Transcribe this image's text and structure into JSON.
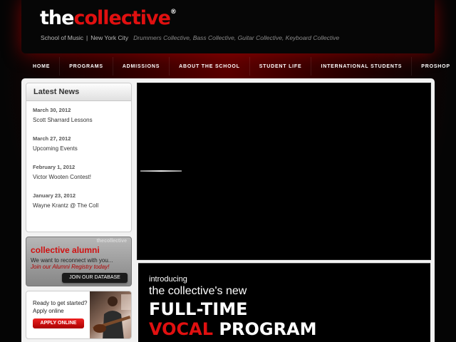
{
  "header": {
    "logo_white": "the",
    "logo_red": "collective",
    "logo_mark": "®",
    "tagline_school": "School of Music",
    "tagline_sep": "|",
    "tagline_city": "New York City",
    "tagline_sub": "Drummers Collective, Bass Collective, Guitar Collective, Keyboard Collective"
  },
  "nav": [
    {
      "label": "HOME"
    },
    {
      "label": "PROGRAMS"
    },
    {
      "label": "ADMISSIONS"
    },
    {
      "label": "ABOUT THE SCHOOL"
    },
    {
      "label": "STUDENT LIFE"
    },
    {
      "label": "INTERNATIONAL STUDENTS"
    },
    {
      "label": "PROSHOP"
    }
  ],
  "news": {
    "title": "Latest News",
    "items": [
      {
        "date": "March 30, 2012",
        "title": "Scott Sharrard Lessons"
      },
      {
        "date": "March 27, 2012",
        "title": "Upcoming Events"
      },
      {
        "date": "February 1, 2012",
        "title": "Victor Wooten Contest!"
      },
      {
        "date": "January 23, 2012",
        "title": "Wayne Krantz @ The Coll"
      }
    ]
  },
  "alumni": {
    "watermark": "thecollective",
    "title": "collective alumni",
    "line1": "We want to reconnect with you...",
    "line2": "Join our Alumni Registry today!",
    "button": "JOIN OUR DATABASE"
  },
  "apply": {
    "line1": "Ready to get started?",
    "line2": "Apply online",
    "button": "APPLY ONLINE"
  },
  "promo": {
    "intro": "introducing",
    "sub": "the collective's new",
    "line1": "FULL-TIME",
    "line2_red": "VOCAL",
    "line2_white": "PROGRAM"
  },
  "colors": {
    "accent": "#e01010",
    "background": "#050505"
  }
}
